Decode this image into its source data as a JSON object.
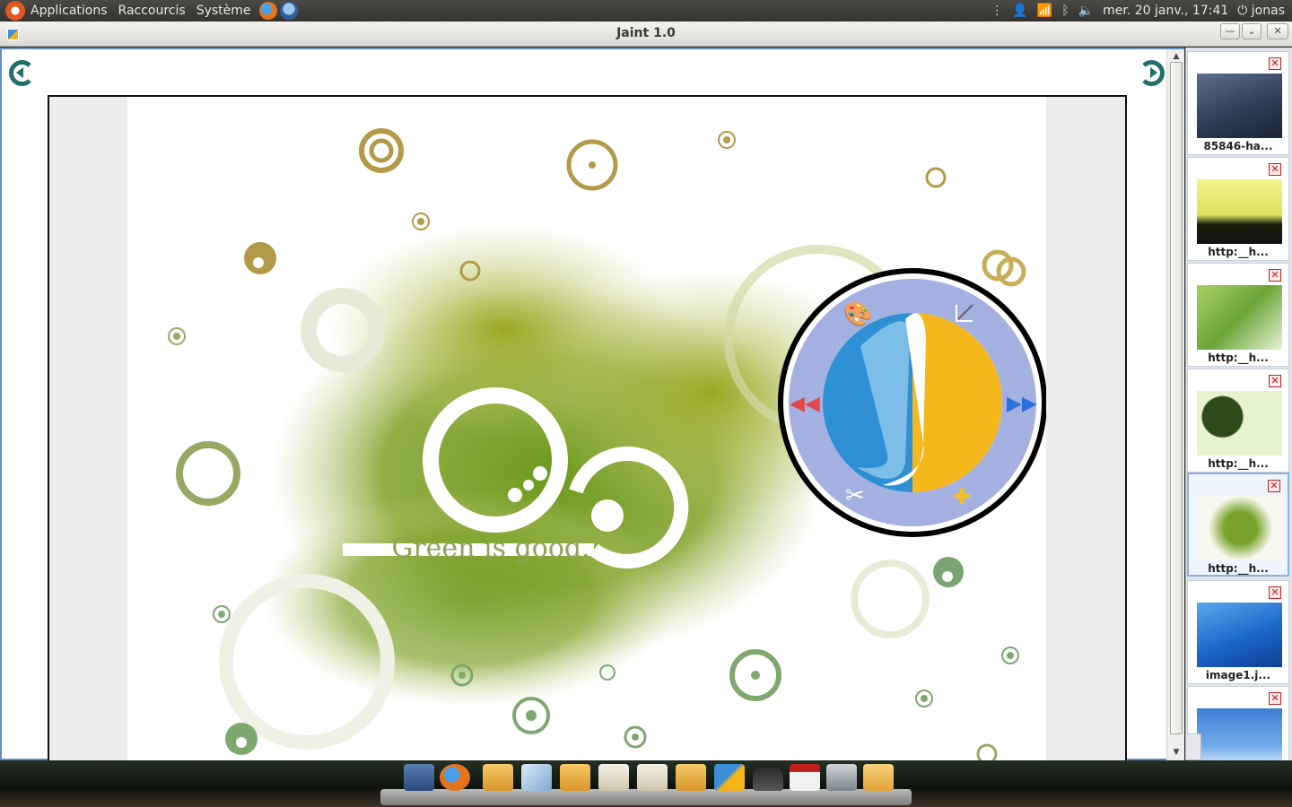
{
  "top_panel": {
    "menus": [
      "Applications",
      "Raccourcis",
      "Système"
    ],
    "clock": "mer. 20 janv., 17:41",
    "user": "jonas"
  },
  "window": {
    "title": "Jaint 1.0"
  },
  "wallpaper": {
    "caption": "Green is good."
  },
  "sidebar": {
    "thumbnails": [
      {
        "label": "85846-ha..."
      },
      {
        "label": "http:__h..."
      },
      {
        "label": "http:__h..."
      },
      {
        "label": "http:__h..."
      },
      {
        "label": "http:__h...",
        "selected": true
      },
      {
        "label": "image1.j..."
      },
      {
        "label": ""
      }
    ]
  },
  "icons": {
    "nav_prev": "undo-arrow-icon",
    "nav_next": "redo-arrow-icon",
    "radial_menu": [
      "palette-icon",
      "crop-icon",
      "prev-arrows-icon",
      "next-arrows-icon",
      "tools-icon",
      "plugin-puzzle-icon"
    ]
  },
  "colors": {
    "accent": "#1f6f6a",
    "selection": "#8cb1e0",
    "radial_ring": "#a4b0e0",
    "wallpaper_green": "#7a9a2a"
  }
}
